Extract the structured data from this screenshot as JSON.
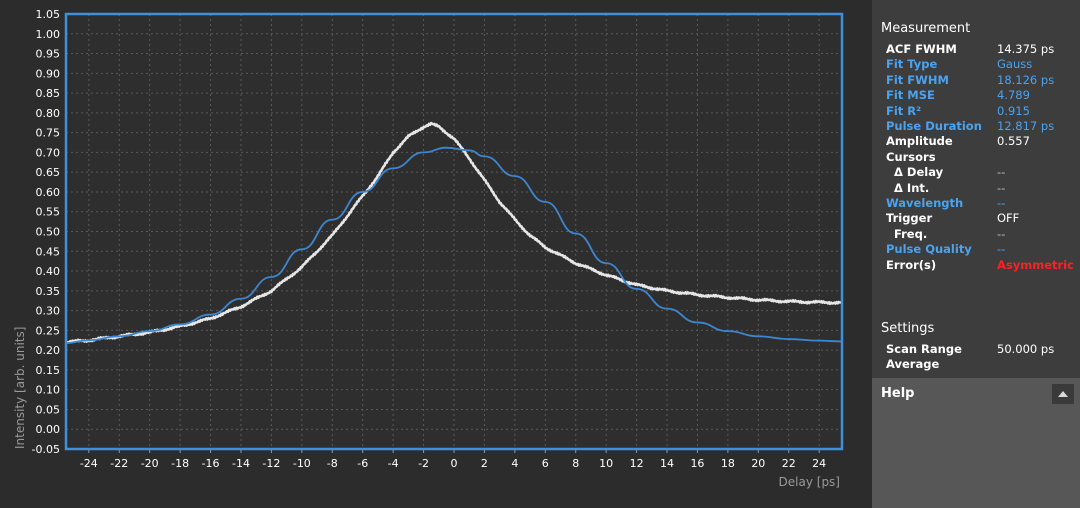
{
  "chart_data": {
    "type": "line",
    "xlabel": "Delay [ps]",
    "ylabel": "Intensity [arb. units]",
    "xlim": [
      -25.5,
      25.5
    ],
    "ylim": [
      -0.05,
      1.05
    ],
    "x_ticks": [
      -24,
      -22,
      -20,
      -18,
      -16,
      -14,
      -12,
      -10,
      -8,
      -6,
      -4,
      -2,
      0,
      2,
      4,
      6,
      8,
      10,
      12,
      14,
      16,
      18,
      20,
      22,
      24
    ],
    "y_ticks": [
      -0.05,
      0.0,
      0.05,
      0.1,
      0.15,
      0.2,
      0.25,
      0.3,
      0.35,
      0.4,
      0.45,
      0.5,
      0.55,
      0.6,
      0.65,
      0.7,
      0.75,
      0.8,
      0.85,
      0.9,
      0.95,
      1.0,
      1.05
    ],
    "grid": true,
    "series": [
      {
        "style": "measured",
        "color": "#e6e6e6",
        "x": [
          -25.5,
          -24,
          -22,
          -20,
          -18,
          -16,
          -14,
          -12,
          -10,
          -8,
          -6,
          -5,
          -4,
          -3,
          -2,
          -1.5,
          -1,
          0,
          1,
          2,
          3,
          4,
          5,
          6,
          8,
          10,
          12,
          14,
          16,
          18,
          20,
          22,
          24,
          25.5
        ],
        "y": [
          0.22,
          0.225,
          0.235,
          0.245,
          0.26,
          0.28,
          0.31,
          0.35,
          0.41,
          0.49,
          0.59,
          0.64,
          0.7,
          0.74,
          0.765,
          0.772,
          0.765,
          0.735,
          0.685,
          0.63,
          0.575,
          0.53,
          0.49,
          0.46,
          0.42,
          0.39,
          0.365,
          0.35,
          0.34,
          0.333,
          0.327,
          0.323,
          0.321,
          0.32
        ]
      },
      {
        "style": "fit",
        "color": "#3d86d0",
        "x": [
          -25.5,
          -24,
          -22,
          -20,
          -18,
          -16,
          -14,
          -12,
          -10,
          -8,
          -6,
          -4,
          -2,
          -0.5,
          1,
          2,
          4,
          6,
          8,
          10,
          12,
          14,
          16,
          18,
          20,
          22,
          24,
          25.5
        ],
        "y": [
          0.218,
          0.225,
          0.235,
          0.248,
          0.265,
          0.29,
          0.33,
          0.385,
          0.455,
          0.53,
          0.6,
          0.66,
          0.7,
          0.712,
          0.705,
          0.69,
          0.64,
          0.575,
          0.495,
          0.42,
          0.355,
          0.305,
          0.27,
          0.248,
          0.235,
          0.228,
          0.224,
          0.222
        ]
      }
    ]
  },
  "panel": {
    "measurement_title": "Measurement",
    "rows": [
      {
        "label": "ACF FWHM",
        "value": "14.375 ps",
        "color": "white"
      },
      {
        "label": "Fit Type",
        "value": "Gauss",
        "color": "blue"
      },
      {
        "label": "Fit FWHM",
        "value": "18.126 ps",
        "color": "blue"
      },
      {
        "label": "Fit MSE",
        "value": "4.789",
        "color": "blue"
      },
      {
        "label": "Fit R²",
        "value": "0.915",
        "color": "blue"
      },
      {
        "label": "Pulse Duration",
        "value": "12.817 ps",
        "color": "blue"
      },
      {
        "label": "Amplitude",
        "value": "0.557",
        "color": "white"
      },
      {
        "label": "Cursors",
        "value": "",
        "color": "white"
      },
      {
        "label": "  Δ Delay",
        "value": "--",
        "color": "white"
      },
      {
        "label": "  Δ Int.",
        "value": "--",
        "color": "white"
      },
      {
        "label": "Wavelength",
        "value": "--",
        "color": "blue"
      },
      {
        "label": "Trigger",
        "value": "OFF",
        "color": "white"
      },
      {
        "label": "  Freq.",
        "value": "--",
        "color": "white"
      },
      {
        "label": "Pulse Quality",
        "value": "--",
        "color": "blue"
      },
      {
        "label": "Error(s)",
        "value": "Asymmetric",
        "color": "white",
        "value_color": "red"
      }
    ],
    "settings_title": "Settings",
    "settings_rows": [
      {
        "label": "Scan Range",
        "value": "50.000 ps"
      },
      {
        "label": "Average",
        "value": ""
      }
    ],
    "help_label": "Help"
  }
}
